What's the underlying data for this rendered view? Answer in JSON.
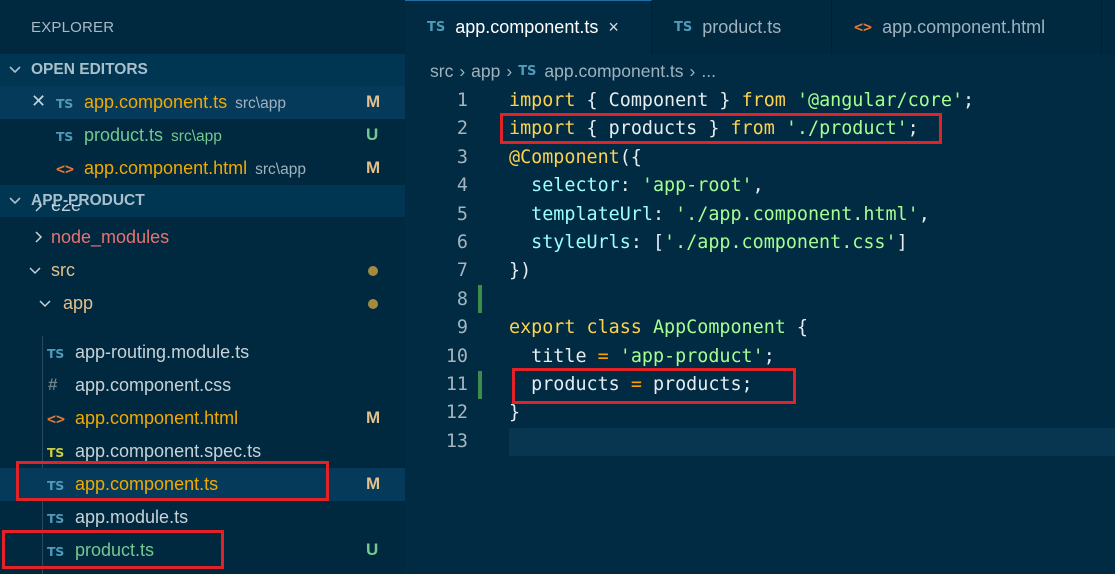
{
  "explorer": {
    "title": "EXPLORER",
    "open_editors_label": "OPEN EDITORS",
    "project_label": "APP-PRODUCT",
    "open_editors": [
      {
        "icon": "TS",
        "name": "app.component.ts",
        "path": "src\\app",
        "status": "M"
      },
      {
        "icon": "TS",
        "name": "product.ts",
        "path": "src\\app",
        "status": "U"
      },
      {
        "icon": "<>",
        "name": "app.component.html",
        "path": "src\\app",
        "status": "M"
      }
    ],
    "tree": {
      "e2e": "e2e",
      "node_modules": "node_modules",
      "src": "src",
      "app": "app",
      "files": [
        {
          "icon": "TS",
          "name": "app-routing.module.ts",
          "status": ""
        },
        {
          "icon": "#",
          "name": "app.component.css",
          "status": ""
        },
        {
          "icon": "<>",
          "name": "app.component.html",
          "status": "M"
        },
        {
          "icon": "TS",
          "name": "app.component.spec.ts",
          "status": ""
        },
        {
          "icon": "TS",
          "name": "app.component.ts",
          "status": "M"
        },
        {
          "icon": "TS",
          "name": "app.module.ts",
          "status": ""
        },
        {
          "icon": "TS",
          "name": "product.ts",
          "status": "U"
        }
      ]
    }
  },
  "tabs": [
    {
      "icon": "TS",
      "label": "app.component.ts",
      "close": "×"
    },
    {
      "icon": "TS",
      "label": "product.ts"
    },
    {
      "icon": "<>",
      "label": "app.component.html"
    }
  ],
  "breadcrumb": {
    "parts": [
      "src",
      "app"
    ],
    "icon": "TS",
    "file": "app.component.ts",
    "trail": "..."
  },
  "code": {
    "line_numbers": [
      "1",
      "2",
      "3",
      "4",
      "5",
      "6",
      "7",
      "8",
      "9",
      "10",
      "11",
      "12",
      "13"
    ],
    "tokens": {
      "import": "import",
      "from": "from",
      "export": "export",
      "class": "class",
      "component": "Component",
      "products": "products",
      "angular_core": "'@angular/core'",
      "product_path": "'./product'",
      "decorator_at": "@",
      "selector": "selector",
      "app_root": "'app-root'",
      "templateUrl": "templateUrl",
      "html_path": "'./app.component.html'",
      "styleUrls": "styleUrls",
      "css_path": "'./app.component.css'",
      "app_component": "AppComponent",
      "title": "title",
      "app_product": "'app-product'",
      "open_brace": "{",
      "close_brace": "}",
      "open_paren_brace": "({",
      "close_brace_paren": "})",
      "semicolon": ";",
      "eq": "=",
      "colon": ":",
      "comma": ",",
      "open_bracket": "[",
      "close_bracket": "]"
    }
  },
  "colors": {
    "annotation_red": "#e32228",
    "git_added_green": "#3c8c4c",
    "keyword": "#ffd24d",
    "string": "#a5ff90"
  }
}
